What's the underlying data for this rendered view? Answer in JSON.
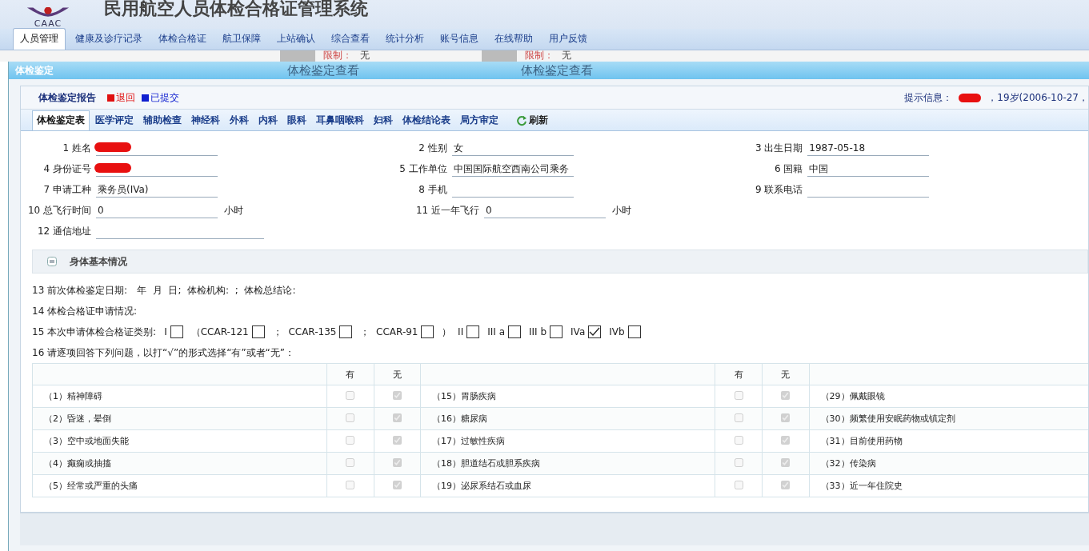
{
  "header": {
    "logo_text": "CAAC",
    "title": "民用航空人员体检合格证管理系统"
  },
  "nav": [
    {
      "label": "人员管理",
      "selected": true
    },
    {
      "label": "健康及诊疗记录",
      "selected": false
    },
    {
      "label": "体检合格证",
      "selected": false
    },
    {
      "label": "航卫保障",
      "selected": false
    },
    {
      "label": "上站确认",
      "selected": false
    },
    {
      "label": "综合查看",
      "selected": false
    },
    {
      "label": "统计分析",
      "selected": false
    },
    {
      "label": "账号信息",
      "selected": false
    },
    {
      "label": "在线帮助",
      "selected": false
    },
    {
      "label": "用户反馈",
      "selected": false
    }
  ],
  "background_cards": [
    {
      "limit_label": "限制：",
      "limit_value": "无",
      "link": "体检鉴定查看"
    },
    {
      "limit_label": "限制：",
      "limit_value": "无",
      "link": "体检鉴定查看"
    }
  ],
  "dialog": {
    "title": "体检鉴定",
    "report_title": "体检鉴定报告",
    "legend": [
      {
        "label": "退回",
        "color": "#e01010"
      },
      {
        "label": "已提交",
        "color": "#1020d0"
      }
    ],
    "hint": {
      "label": "提示信息：",
      "redacted": true,
      "text": "，19岁(2006-10-27，"
    },
    "tabs": [
      {
        "label": "体检鉴定表",
        "selected": true
      },
      {
        "label": "医学评定",
        "selected": false
      },
      {
        "label": "辅助检查",
        "selected": false
      },
      {
        "label": "神经科",
        "selected": false
      },
      {
        "label": "外科",
        "selected": false
      },
      {
        "label": "内科",
        "selected": false
      },
      {
        "label": "眼科",
        "selected": false
      },
      {
        "label": "耳鼻咽喉科",
        "selected": false
      },
      {
        "label": "妇科",
        "selected": false
      },
      {
        "label": "体检结论表",
        "selected": false
      },
      {
        "label": "局方审定",
        "selected": false
      }
    ],
    "refresh": "刷新",
    "fields": [
      [
        {
          "label": "1 姓名",
          "redacted": true
        },
        {
          "label": "2 性别",
          "value": "女",
          "redacted": false
        },
        {
          "label": "3 出生日期",
          "value": "1987-05-18",
          "redacted": false
        }
      ],
      [
        {
          "label": "4 身份证号",
          "redacted": true
        },
        {
          "label": "5 工作单位",
          "value": "中国国际航空西南公司乘务",
          "redacted": false
        },
        {
          "label": "6 国籍",
          "value": "中国",
          "redacted": false
        }
      ],
      [
        {
          "label": "7 申请工种",
          "value": "乘务员(IVa)",
          "redacted": false
        },
        {
          "label": "8 手机",
          "redacted": false
        },
        {
          "label": "9 联系电话",
          "redacted": false
        }
      ],
      [
        {
          "label": "10 总飞行时间",
          "value": "0",
          "redacted": false,
          "suffix": "小时"
        },
        {
          "label": "11 近一年飞行",
          "value": "0",
          "redacted": false,
          "suffix": "小时"
        }
      ],
      [
        {
          "label": "12 通信地址",
          "redacted": false
        }
      ]
    ],
    "section_title": "身体基本情况",
    "q13": "13 前次体检鉴定日期:　年  月  日;  体检机构:  ;  体检总结论:",
    "q14": "14 体检合格证申请情况:",
    "q15_label": "15 本次申请体检合格证类别:",
    "q15_parts": [
      {
        "kind": "text",
        "text": "I"
      },
      {
        "kind": "box",
        "checked": false
      },
      {
        "kind": "text",
        "text": "（CCAR-121"
      },
      {
        "kind": "box",
        "checked": false
      },
      {
        "kind": "text",
        "text": "；  CCAR-135"
      },
      {
        "kind": "box",
        "checked": false
      },
      {
        "kind": "text",
        "text": "；  CCAR-91"
      },
      {
        "kind": "box",
        "checked": false
      },
      {
        "kind": "text",
        "text": "）  II"
      },
      {
        "kind": "box",
        "checked": false
      },
      {
        "kind": "text",
        "text": "III a"
      },
      {
        "kind": "box",
        "checked": false
      },
      {
        "kind": "text",
        "text": "III b"
      },
      {
        "kind": "box",
        "checked": false
      },
      {
        "kind": "text",
        "text": "IVa"
      },
      {
        "kind": "box",
        "checked": true
      },
      {
        "kind": "text",
        "text": "IVb"
      },
      {
        "kind": "box",
        "checked": false
      }
    ],
    "q16": "16 请逐项回答下列问题，以打“√”的形式选择“有”或者“无”：",
    "table_headers": [
      {
        "yes": "有",
        "no": "无"
      },
      {
        "yes": "有",
        "no": "无"
      }
    ],
    "rows": [
      [
        {
          "label": "（1）精神障碍",
          "yes": false,
          "no": true
        },
        {
          "label": "（15）胃肠疾病",
          "yes": false,
          "no": true
        },
        {
          "label": "（29）佩戴眼镜"
        }
      ],
      [
        {
          "label": "（2）昏迷，晕倒",
          "yes": false,
          "no": true
        },
        {
          "label": "（16）糖尿病",
          "yes": false,
          "no": true
        },
        {
          "label": "（30）频繁使用安眠药物或镇定剂"
        }
      ],
      [
        {
          "label": "（3）空中或地面失能",
          "yes": false,
          "no": true
        },
        {
          "label": "（17）过敏性疾病",
          "yes": false,
          "no": true
        },
        {
          "label": "（31）目前使用药物"
        }
      ],
      [
        {
          "label": "（4）癫痫或抽搐",
          "yes": false,
          "no": true
        },
        {
          "label": "（18）胆道结石或胆系疾病",
          "yes": false,
          "no": true
        },
        {
          "label": "（32）传染病"
        }
      ],
      [
        {
          "label": "（5）经常或严重的头痛",
          "yes": false,
          "no": true
        },
        {
          "label": "（19）泌尿系结石或血尿",
          "yes": false,
          "no": true
        },
        {
          "label": "（33）近一年住院史"
        }
      ]
    ]
  }
}
